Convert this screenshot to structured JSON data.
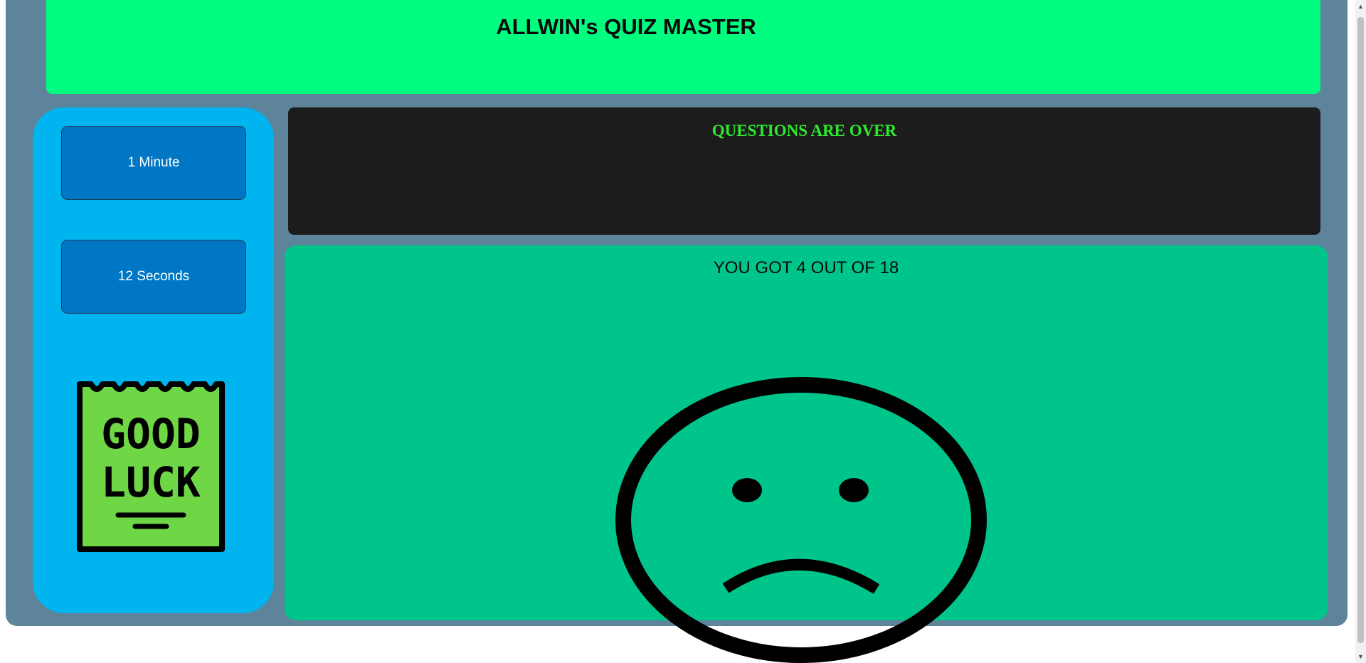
{
  "header": {
    "title": "ALLWIN's QUIZ MASTER"
  },
  "sidebar": {
    "timer_minutes_label": "1 Minute",
    "timer_seconds_label": "12 Seconds",
    "good_luck_icon": "good-luck-note-icon",
    "good_luck_text_line1": "GOOD",
    "good_luck_text_line2": "LUCK"
  },
  "question": {
    "text": "QUESTIONS ARE OVER"
  },
  "result": {
    "score_text": "YOU GOT 4 OUT OF 18",
    "face_icon": "sad-face-icon"
  },
  "colors": {
    "header_bg": "#00fd80",
    "frame_bg": "#5d849b",
    "sidebar_bg": "#00b4f0",
    "button_bg": "#0077c4",
    "question_bg": "#1c1c1c",
    "question_text": "#2ee82e",
    "result_bg": "#00c58b",
    "note_fill": "#6fd645"
  }
}
